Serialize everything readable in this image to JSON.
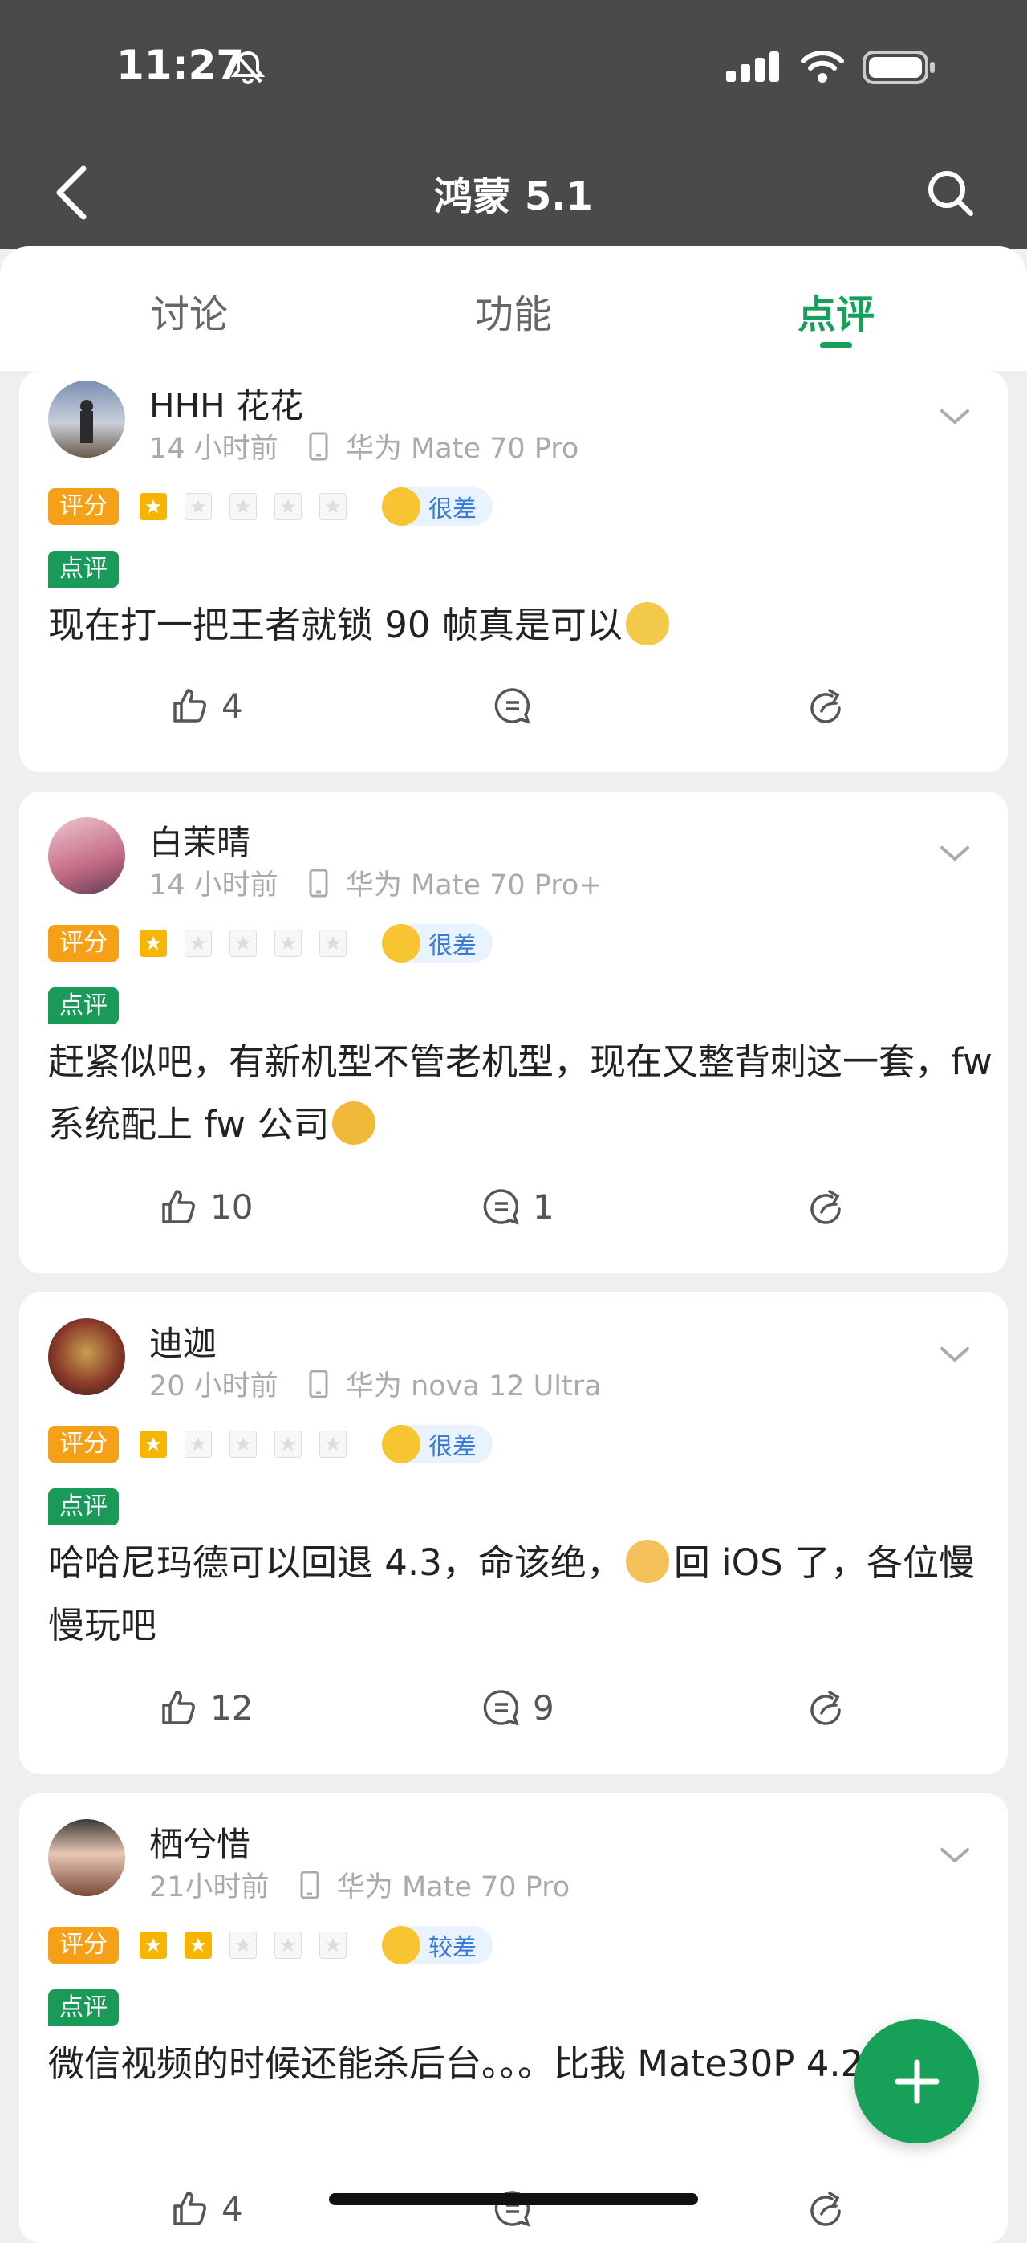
{
  "status_bar": {
    "time": "11:27"
  },
  "nav": {
    "title": "鸿蒙 5.1"
  },
  "tabs": [
    {
      "label": "讨论"
    },
    {
      "label": "功能"
    },
    {
      "label": "点评"
    }
  ],
  "labels": {
    "score_badge": "评分",
    "review_badge": "点评"
  },
  "reviews": [
    {
      "user": "HHH 花花",
      "time": "14 小时前",
      "device": "华为 Mate 70 Pro",
      "stars": 1,
      "rating_text": "很差",
      "content": "现在打一把王者就锁 90 帧真是可以",
      "likes": "4",
      "comments": ""
    },
    {
      "user": "白茉晴",
      "time": "14 小时前",
      "device": "华为 Mate 70 Pro+",
      "stars": 1,
      "rating_text": "很差",
      "content": "赶紧似吧，有新机型不管老机型，现在又整背刺这一套，fw 系统配上 fw 公司",
      "likes": "10",
      "comments": "1"
    },
    {
      "user": "迪迦",
      "time": "20 小时前",
      "device": "华为 nova 12 Ultra",
      "stars": 1,
      "rating_text": "很差",
      "content_a": "哈哈尼玛德可以回退 4.3，命该绝，",
      "content_b": "回 iOS 了，各位慢慢玩吧",
      "likes": "12",
      "comments": "9"
    },
    {
      "user": "栖兮惜",
      "time": "21小时前",
      "device": "华为 Mate 70 Pro",
      "stars": 2,
      "rating_text": "较差",
      "content": "微信视频的时候还能杀后台。。。比我 Mate30P 4.2 还拉",
      "likes": "4",
      "comments": ""
    }
  ],
  "colors": {
    "accent": "#16a05a",
    "score_badge": "#f6a018",
    "star": "#f6b500",
    "header": "#4a4a4a"
  }
}
